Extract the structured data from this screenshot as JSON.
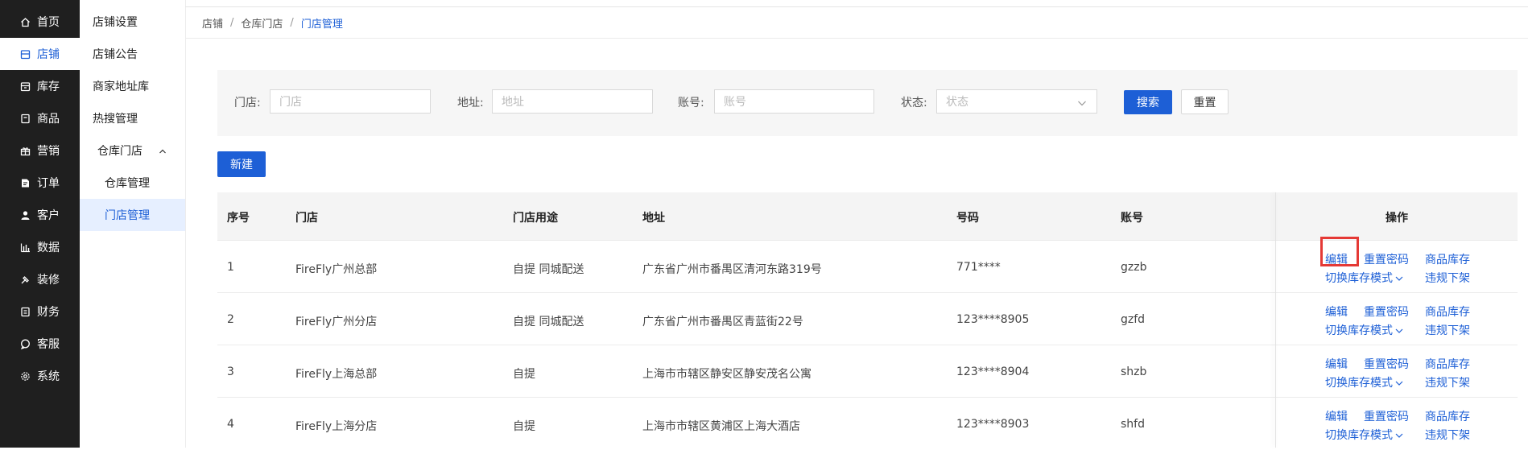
{
  "main_nav": [
    {
      "label": "首页",
      "icon": "home-icon"
    },
    {
      "label": "店铺",
      "icon": "store-icon",
      "active": true
    },
    {
      "label": "库存",
      "icon": "inventory-icon"
    },
    {
      "label": "商品",
      "icon": "product-icon"
    },
    {
      "label": "营销",
      "icon": "gift-icon"
    },
    {
      "label": "订单",
      "icon": "order-icon"
    },
    {
      "label": "客户",
      "icon": "user-icon"
    },
    {
      "label": "数据",
      "icon": "chart-icon"
    },
    {
      "label": "装修",
      "icon": "decor-icon"
    },
    {
      "label": "财务",
      "icon": "finance-icon"
    },
    {
      "label": "客服",
      "icon": "chat-icon"
    },
    {
      "label": "系统",
      "icon": "gear-icon"
    }
  ],
  "sub_nav": {
    "items": [
      "店铺设置",
      "店铺公告",
      "商家地址库",
      "热搜管理"
    ],
    "group": "仓库门店",
    "children": [
      "仓库管理",
      "门店管理"
    ],
    "active_child": "门店管理"
  },
  "breadcrumb": [
    "店铺",
    "仓库门店",
    "门店管理"
  ],
  "filters": {
    "store": {
      "label": "门店:",
      "placeholder": "门店"
    },
    "address": {
      "label": "地址:",
      "placeholder": "地址"
    },
    "account": {
      "label": "账号:",
      "placeholder": "账号"
    },
    "status": {
      "label": "状态:",
      "placeholder": "状态"
    },
    "search_label": "搜索",
    "reset_label": "重置"
  },
  "new_button_label": "新建",
  "table": {
    "headers": [
      "序号",
      "门店",
      "门店用途",
      "地址",
      "号码",
      "账号",
      "操作"
    ],
    "rows": [
      {
        "no": "1",
        "store": "FireFly广州总部",
        "usage": "自提 同城配送",
        "address": "广东省广州市番禺区清河东路319号",
        "phone": "771****",
        "account": "gzzb"
      },
      {
        "no": "2",
        "store": "FireFly广州分店",
        "usage": "自提 同城配送",
        "address": "广东省广州市番禺区青蓝街22号",
        "phone": "123****8905",
        "account": "gzfd"
      },
      {
        "no": "3",
        "store": "FireFly上海总部",
        "usage": "自提",
        "address": "上海市市辖区静安区静安茂名公寓",
        "phone": "123****8904",
        "account": "shzb"
      },
      {
        "no": "4",
        "store": "FireFly上海分店",
        "usage": "自提",
        "address": "上海市市辖区黄浦区上海大酒店",
        "phone": "123****8903",
        "account": "shfd"
      }
    ],
    "actions": {
      "edit": "编辑",
      "reset_password": "重置密码",
      "product_stock": "商品库存",
      "switch_mode": "切换库存模式",
      "delist": "违规下架"
    }
  },
  "colors": {
    "primary": "#1d5fd6",
    "highlight": "#e53935",
    "sidebar": "#1f1f1f"
  }
}
